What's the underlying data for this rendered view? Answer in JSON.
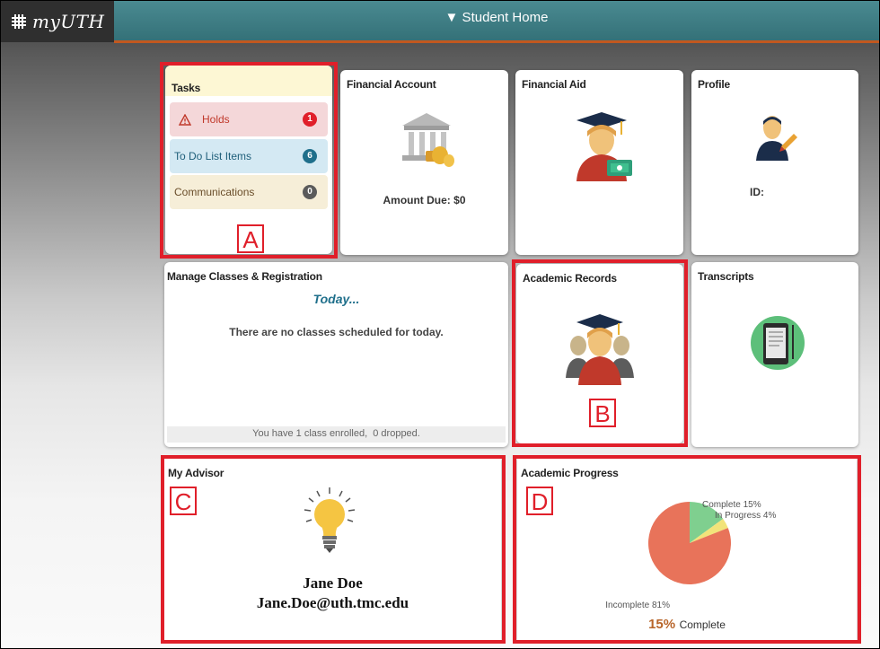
{
  "header": {
    "app_name": "myUTH",
    "nav_title": "▼ Student Home"
  },
  "colors": {
    "banner": "#3d7d84",
    "banner_underline": "#c2581f",
    "highlight": "#e01f2a",
    "holds_bg": "#f4d7d9",
    "todo_bg": "#d4e9f3",
    "comm_bg": "#f6eed8"
  },
  "tasks": {
    "title": "Tasks",
    "items": [
      {
        "label": "Holds",
        "count": "1",
        "icon": "warning-triangle-icon"
      },
      {
        "label": "To Do List Items",
        "count": "6"
      },
      {
        "label": "Communications",
        "count": "0"
      }
    ]
  },
  "financial_account": {
    "title": "Financial Account",
    "amount_due": "Amount Due: $0",
    "icon": "bank-money-icon"
  },
  "financial_aid": {
    "title": "Financial Aid",
    "icon": "graduate-money-icon"
  },
  "profile": {
    "title": "Profile",
    "id_label": "ID:",
    "icon": "user-edit-icon"
  },
  "manage_classes": {
    "title": "Manage Classes & Registration",
    "today": "Today...",
    "no_classes": "There are no classes scheduled for today.",
    "enrollment": "You have 1 class enrolled,  0 dropped."
  },
  "academic_records": {
    "title": "Academic Records",
    "icon": "graduates-icon"
  },
  "transcripts": {
    "title": "Transcripts",
    "icon": "tablet-document-icon"
  },
  "advisor": {
    "title": "My Advisor",
    "name": "Jane Doe",
    "email": "Jane.Doe@uth.tmc.edu",
    "icon": "lightbulb-icon"
  },
  "academic_progress": {
    "title": "Academic Progress",
    "summary_value": "15%",
    "summary_label": "Complete",
    "chart_data": {
      "type": "pie",
      "slices": [
        {
          "label": "Complete 15%",
          "value": 15,
          "color": "#7fcf8f"
        },
        {
          "label": "In Progress 4%",
          "value": 4,
          "color": "#f2e37a"
        },
        {
          "label": "Incomplete 81%",
          "value": 81,
          "color": "#e8735a"
        }
      ]
    }
  },
  "annotations": {
    "a": "A",
    "b": "B",
    "c": "C",
    "d": "D"
  }
}
